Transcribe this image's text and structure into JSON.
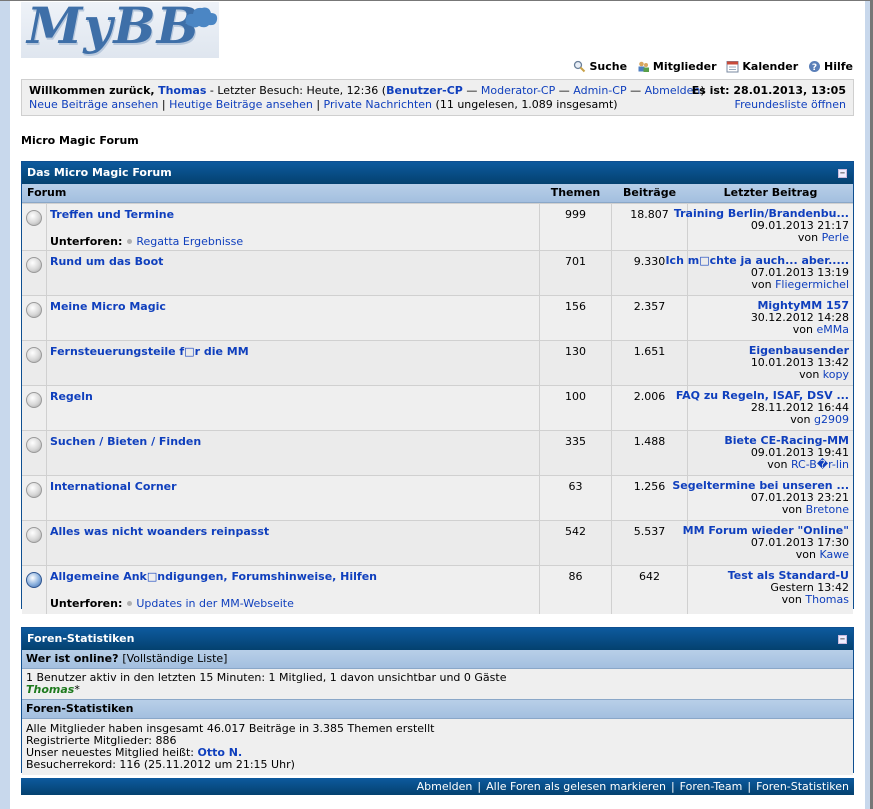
{
  "header": {
    "logo_text": "MyBB",
    "menu": [
      {
        "label": "Suche",
        "icon": "search-icon"
      },
      {
        "label": "Mitglieder",
        "icon": "members-icon"
      },
      {
        "label": "Kalender",
        "icon": "calendar-icon"
      },
      {
        "label": "Hilfe",
        "icon": "help-icon"
      }
    ]
  },
  "welcome": {
    "greeting": "Willkommen zurück,",
    "username": "Thomas",
    "last_visit": "- Letzter Besuch: Heute, 12:36",
    "open_paren": "(",
    "user_cp": "Benutzer-CP",
    "dash1": "—",
    "mod_cp": "Moderator-CP",
    "dash2": "—",
    "admin_cp": "Admin-CP",
    "dash3": "—",
    "logout": "Abmelden",
    "close_paren": ")",
    "new_posts": "Neue Beiträge ansehen",
    "sep1": "|",
    "todays_posts": "Heutige Beiträge ansehen",
    "sep2": "|",
    "pm": "Private Nachrichten",
    "pm_count": "(11 ungelesen, 1.089 insgesamt)",
    "time_label": "Es ist: 28.01.2013, 13:05",
    "buddy_list": "Freundesliste öffnen"
  },
  "breadcrumb": "Micro Magic Forum",
  "forum_table": {
    "title": "Das Micro Magic Forum",
    "columns": {
      "forum": "Forum",
      "threads": "Themen",
      "posts": "Beiträge",
      "last": "Letzter Beitrag"
    },
    "subforums_label": "Unterforen:",
    "by_label": "von",
    "rows": [
      {
        "name": "Treffen und Termine",
        "threads": "999",
        "posts": "18.807",
        "last_title": "Training Berlin/Brandenbu...",
        "last_date": "09.01.2013 21:17",
        "last_user": "Perle",
        "subforum": "Regatta Ergebnisse"
      },
      {
        "name": "Rund um das Boot",
        "threads": "701",
        "posts": "9.330",
        "last_title": "Ich m□chte ja auch... aber.....",
        "last_date": "07.01.2013 13:19",
        "last_user": "Fliegermichel"
      },
      {
        "name": "Meine Micro Magic",
        "threads": "156",
        "posts": "2.357",
        "last_title": "MightyMM 157",
        "last_date": "30.12.2012 14:28",
        "last_user": "eMMa"
      },
      {
        "name": "Fernsteuerungsteile f□r die MM",
        "threads": "130",
        "posts": "1.651",
        "last_title": "Eigenbausender",
        "last_date": "10.01.2013 13:42",
        "last_user": "kopy"
      },
      {
        "name": "Regeln",
        "threads": "100",
        "posts": "2.006",
        "last_title": "FAQ zu Regeln, ISAF, DSV ...",
        "last_date": "28.11.2012 16:44",
        "last_user": "g2909"
      },
      {
        "name": "Suchen / Bieten / Finden",
        "threads": "335",
        "posts": "1.488",
        "last_title": "Biete CE-Racing-MM",
        "last_date": "09.01.2013 19:41",
        "last_user": "RC-B�r-lin"
      },
      {
        "name": "International Corner",
        "threads": "63",
        "posts": "1.256",
        "last_title": "Segeltermine bei unseren ...",
        "last_date": "07.01.2013 23:21",
        "last_user": "Bretone"
      },
      {
        "name": "Alles was nicht woanders reinpasst",
        "threads": "542",
        "posts": "5.537",
        "last_title": "MM Forum wieder \"Online\"",
        "last_date": "07.01.2013 17:30",
        "last_user": "Kawe"
      },
      {
        "name": "Allgemeine Ank□ndigungen, Forumshinweise, Hilfen",
        "threads": "86",
        "posts": "642",
        "last_title": "Test als Standard-U",
        "last_date": "Gestern 13:42",
        "last_user": "Thomas",
        "subforum": "Updates in der MM-Webseite"
      }
    ]
  },
  "stats": {
    "title": "Foren-Statistiken",
    "online_heading": "Wer ist online?",
    "online_full_list": "[Vollständige Liste]",
    "online_text": "1 Benutzer aktiv in den letzten 15 Minuten: 1 Mitglied, 1 davon unsichtbar und 0 Gäste",
    "online_user": "Thomas",
    "online_star": "*",
    "stats_heading": "Foren-Statistiken",
    "line1": "Alle Mitglieder haben insgesamt 46.017 Beiträge in 3.385 Themen erstellt",
    "line2": "Registrierte Mitglieder: 886",
    "line3_prefix": "Unser neuestes Mitglied heißt:",
    "line3_user": "Otto N.",
    "line4": "Besucherrekord: 116 (25.11.2012 um 21:15 Uhr)"
  },
  "footer": {
    "links": [
      "Abmelden",
      "Alle Foren als gelesen markieren",
      "Foren-Team",
      "Foren-Statistiken"
    ],
    "sep": "|"
  },
  "colors": {
    "header_blue": "#04416f",
    "link": "#0f3fbd",
    "online_user": "#1e7a1e"
  }
}
